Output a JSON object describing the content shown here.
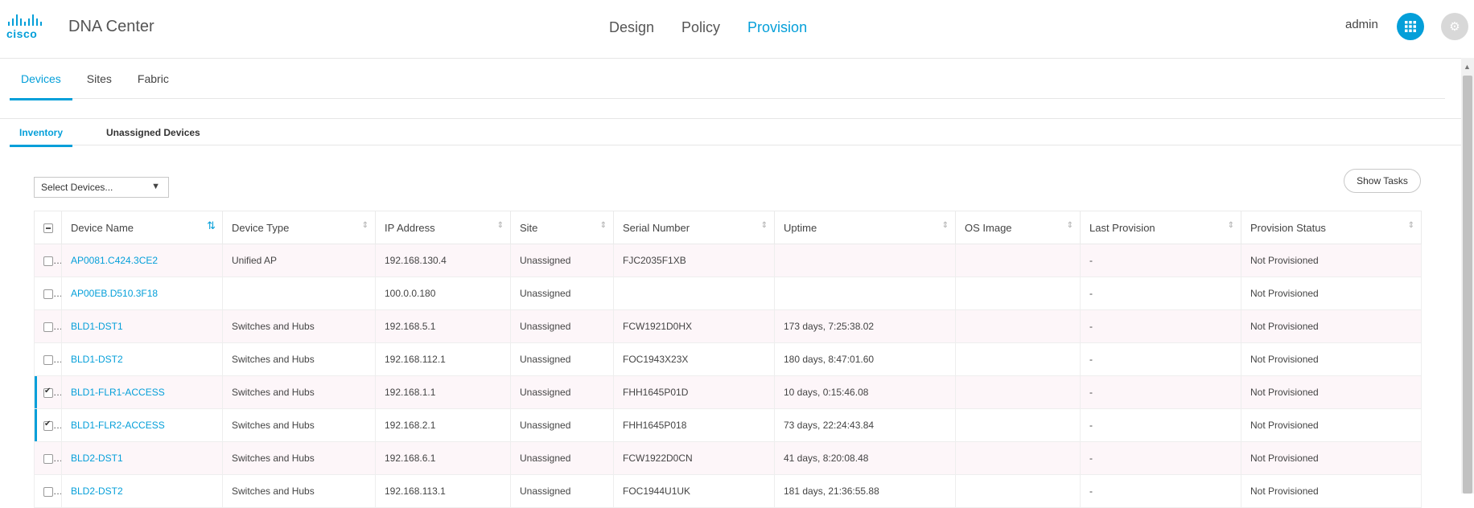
{
  "app": {
    "logo_text": "cisco",
    "title": "DNA Center",
    "user": "admin"
  },
  "nav": {
    "items": [
      {
        "label": "Design",
        "active": false
      },
      {
        "label": "Policy",
        "active": false
      },
      {
        "label": "Provision",
        "active": true
      }
    ]
  },
  "section_tabs": [
    {
      "label": "Devices",
      "active": true
    },
    {
      "label": "Sites",
      "active": false
    },
    {
      "label": "Fabric",
      "active": false
    }
  ],
  "sub_tabs": [
    {
      "label": "Inventory",
      "active": true
    },
    {
      "label": "Unassigned Devices",
      "active": false
    }
  ],
  "controls": {
    "select_devices": "Select Devices...",
    "show_tasks": "Show Tasks"
  },
  "table": {
    "columns": [
      "Device Name",
      "Device Type",
      "IP Address",
      "Site",
      "Serial Number",
      "Uptime",
      "OS Image",
      "Last Provision",
      "Provision Status"
    ],
    "rows": [
      {
        "checked": false,
        "name": "AP0081.C424.3CE2",
        "type": "Unified AP",
        "ip": "192.168.130.4",
        "site": "Unassigned",
        "serial": "FJC2035F1XB",
        "uptime": "",
        "os": "",
        "last": "-",
        "status": "Not Provisioned"
      },
      {
        "checked": false,
        "name": "AP00EB.D510.3F18",
        "type": "",
        "ip": "100.0.0.180",
        "site": "Unassigned",
        "serial": "",
        "uptime": "",
        "os": "",
        "last": "-",
        "status": "Not Provisioned"
      },
      {
        "checked": false,
        "name": "BLD1-DST1",
        "type": "Switches and Hubs",
        "ip": "192.168.5.1",
        "site": "Unassigned",
        "serial": "FCW1921D0HX",
        "uptime": "173 days, 7:25:38.02",
        "os": "",
        "last": "-",
        "status": "Not Provisioned"
      },
      {
        "checked": false,
        "name": "BLD1-DST2",
        "type": "Switches and Hubs",
        "ip": "192.168.112.1",
        "site": "Unassigned",
        "serial": "FOC1943X23X",
        "uptime": "180 days, 8:47:01.60",
        "os": "",
        "last": "-",
        "status": "Not Provisioned"
      },
      {
        "checked": true,
        "name": "BLD1-FLR1-ACCESS",
        "type": "Switches and Hubs",
        "ip": "192.168.1.1",
        "site": "Unassigned",
        "serial": "FHH1645P01D",
        "uptime": "10 days, 0:15:46.08",
        "os": "",
        "last": "-",
        "status": "Not Provisioned"
      },
      {
        "checked": true,
        "name": "BLD1-FLR2-ACCESS",
        "type": "Switches and Hubs",
        "ip": "192.168.2.1",
        "site": "Unassigned",
        "serial": "FHH1645P018",
        "uptime": "73 days, 22:24:43.84",
        "os": "",
        "last": "-",
        "status": "Not Provisioned"
      },
      {
        "checked": false,
        "name": "BLD2-DST1",
        "type": "Switches and Hubs",
        "ip": "192.168.6.1",
        "site": "Unassigned",
        "serial": "FCW1922D0CN",
        "uptime": "41 days, 8:20:08.48",
        "os": "",
        "last": "-",
        "status": "Not Provisioned"
      },
      {
        "checked": false,
        "name": "BLD2-DST2",
        "type": "Switches and Hubs",
        "ip": "192.168.113.1",
        "site": "Unassigned",
        "serial": "FOC1944U1UK",
        "uptime": "181 days, 21:36:55.88",
        "os": "",
        "last": "-",
        "status": "Not Provisioned"
      }
    ]
  },
  "colors": {
    "accent": "#049fd9",
    "row_tint": "#fdf6f9"
  }
}
